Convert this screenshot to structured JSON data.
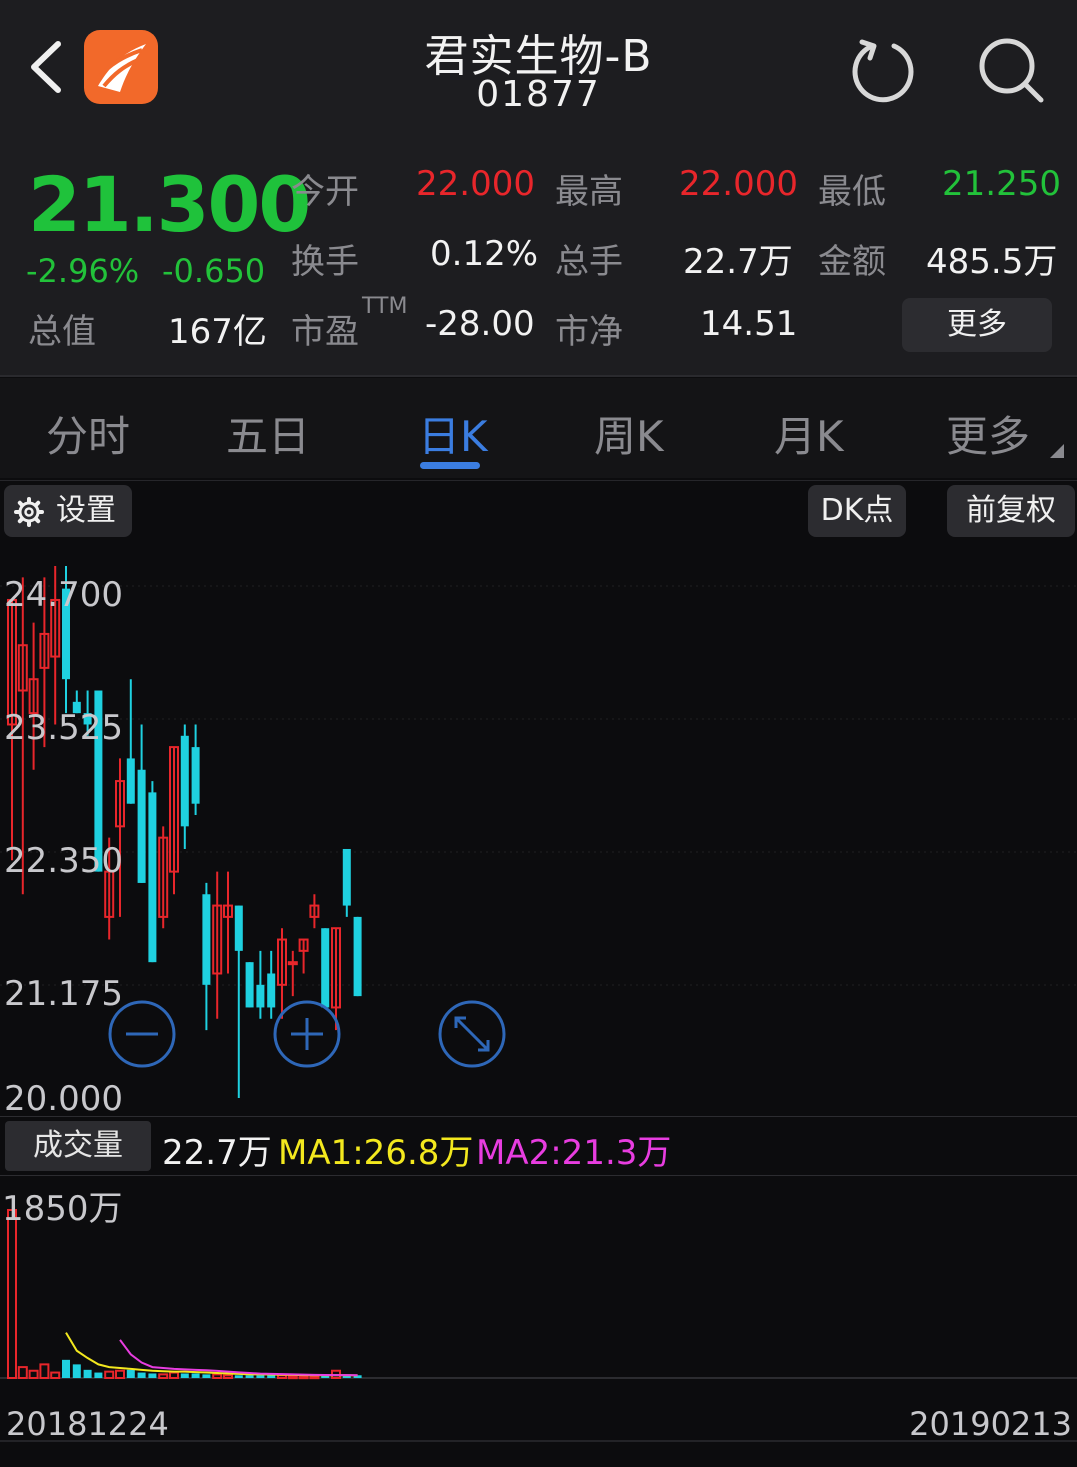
{
  "header": {
    "title": "君实生物-B",
    "code": "01877"
  },
  "quote": {
    "price": "21.300",
    "change_pct": "-2.96%",
    "change": "-0.650",
    "market_cap_label": "总值",
    "market_cap": "167亿",
    "open_label": "今开",
    "open": "22.000",
    "high_label": "最高",
    "high": "22.000",
    "low_label": "最低",
    "low": "21.250",
    "turnover_label": "换手",
    "turnover": "0.12%",
    "volume_label": "总手",
    "volume": "22.7万",
    "amount_label": "金额",
    "amount": "485.5万",
    "pe_label": "市盈",
    "pe_sup": "TTM",
    "pe": "-28.00",
    "pb_label": "市净",
    "pb": "14.51",
    "more_label": "更多"
  },
  "tabs": [
    {
      "label": "分时"
    },
    {
      "label": "五日"
    },
    {
      "label": "日K"
    },
    {
      "label": "周K"
    },
    {
      "label": "月K"
    },
    {
      "label": "更多"
    }
  ],
  "toolbar": {
    "settings_label": "设置",
    "dk_label": "DK点",
    "adjust_label": "前复权"
  },
  "colors": {
    "up": "#e8262b",
    "down": "#1fd1e0",
    "ma1": "#f3e81e",
    "ma2": "#e83de0",
    "accent": "#3b7de0"
  },
  "volume_panel": {
    "label": "成交量",
    "value": "22.7万",
    "ma1": "MA1:26.8万",
    "ma2": "MA2:21.3万",
    "max_label": "1850万"
  },
  "chart_data": {
    "type": "candlestick",
    "price_ticks": [
      "24.700",
      "23.525",
      "22.350",
      "21.175",
      "20.000"
    ],
    "ylim": [
      20.0,
      24.7
    ],
    "vol_max": 1850,
    "date_start": "20181224",
    "date_end": "20190213",
    "candles": [
      {
        "o": 23.3,
        "h": 24.4,
        "l": 22.1,
        "c": 24.4
      },
      {
        "o": 23.6,
        "h": 24.6,
        "l": 21.8,
        "c": 24.0
      },
      {
        "o": 23.4,
        "h": 24.2,
        "l": 22.9,
        "c": 23.7
      },
      {
        "o": 23.8,
        "h": 24.6,
        "l": 23.1,
        "c": 24.1
      },
      {
        "o": 23.9,
        "h": 24.7,
        "l": 23.3,
        "c": 24.4
      },
      {
        "o": 24.5,
        "h": 24.7,
        "l": 23.4,
        "c": 23.7
      },
      {
        "o": 23.5,
        "h": 23.6,
        "l": 23.4,
        "c": 23.4
      },
      {
        "o": 23.4,
        "h": 23.6,
        "l": 23.2,
        "c": 23.3
      },
      {
        "o": 23.6,
        "h": 23.6,
        "l": 22.0,
        "c": 22.0
      },
      {
        "o": 21.6,
        "h": 22.3,
        "l": 21.4,
        "c": 22.0
      },
      {
        "o": 22.4,
        "h": 23.0,
        "l": 21.6,
        "c": 22.8
      },
      {
        "o": 23.0,
        "h": 23.7,
        "l": 22.6,
        "c": 22.6
      },
      {
        "o": 22.9,
        "h": 23.3,
        "l": 21.9,
        "c": 21.9
      },
      {
        "o": 22.7,
        "h": 22.8,
        "l": 21.2,
        "c": 21.2
      },
      {
        "o": 21.6,
        "h": 22.4,
        "l": 21.5,
        "c": 22.3
      },
      {
        "o": 22.0,
        "h": 23.1,
        "l": 21.8,
        "c": 23.1
      },
      {
        "o": 23.2,
        "h": 23.3,
        "l": 22.2,
        "c": 22.4
      },
      {
        "o": 23.1,
        "h": 23.3,
        "l": 22.5,
        "c": 22.6
      },
      {
        "o": 21.8,
        "h": 21.9,
        "l": 20.6,
        "c": 21.0
      },
      {
        "o": 21.1,
        "h": 22.0,
        "l": 20.7,
        "c": 21.7
      },
      {
        "o": 21.6,
        "h": 22.0,
        "l": 21.1,
        "c": 21.7
      },
      {
        "o": 21.7,
        "h": 21.7,
        "l": 20.0,
        "c": 21.3
      },
      {
        "o": 21.2,
        "h": 21.2,
        "l": 20.8,
        "c": 20.8
      },
      {
        "o": 21.0,
        "h": 21.3,
        "l": 20.7,
        "c": 20.8
      },
      {
        "o": 21.1,
        "h": 21.3,
        "l": 20.7,
        "c": 20.8
      },
      {
        "o": 21.0,
        "h": 21.5,
        "l": 20.7,
        "c": 21.4
      },
      {
        "o": 21.2,
        "h": 21.3,
        "l": 20.9,
        "c": 21.2
      },
      {
        "o": 21.3,
        "h": 21.4,
        "l": 21.1,
        "c": 21.4
      },
      {
        "o": 21.6,
        "h": 21.8,
        "l": 21.5,
        "c": 21.7
      },
      {
        "o": 21.5,
        "h": 21.5,
        "l": 20.8,
        "c": 20.8
      },
      {
        "o": 20.8,
        "h": 21.5,
        "l": 20.6,
        "c": 21.5
      },
      {
        "o": 22.2,
        "h": 22.2,
        "l": 21.6,
        "c": 21.7
      },
      {
        "o": 21.6,
        "h": 21.6,
        "l": 20.9,
        "c": 20.9
      }
    ],
    "volumes": [
      1850,
      120,
      80,
      150,
      60,
      200,
      150,
      90,
      60,
      70,
      80,
      90,
      60,
      50,
      40,
      60,
      50,
      50,
      40,
      40,
      30,
      30,
      30,
      30,
      30,
      30,
      20,
      20,
      20,
      30,
      80,
      40,
      30
    ],
    "ma1": [
      null,
      null,
      null,
      null,
      null,
      500,
      300,
      220,
      150,
      120,
      110,
      100,
      90,
      80,
      75,
      70,
      70,
      65,
      60,
      55,
      50,
      45,
      40,
      40,
      38,
      36,
      34,
      32,
      30,
      30,
      32,
      30,
      29
    ],
    "ma2": [
      null,
      null,
      null,
      null,
      null,
      null,
      null,
      null,
      null,
      null,
      420,
      260,
      170,
      120,
      110,
      100,
      95,
      90,
      85,
      78,
      70,
      62,
      55,
      48,
      45,
      42,
      40,
      37,
      35,
      33,
      32,
      31,
      30
    ]
  }
}
